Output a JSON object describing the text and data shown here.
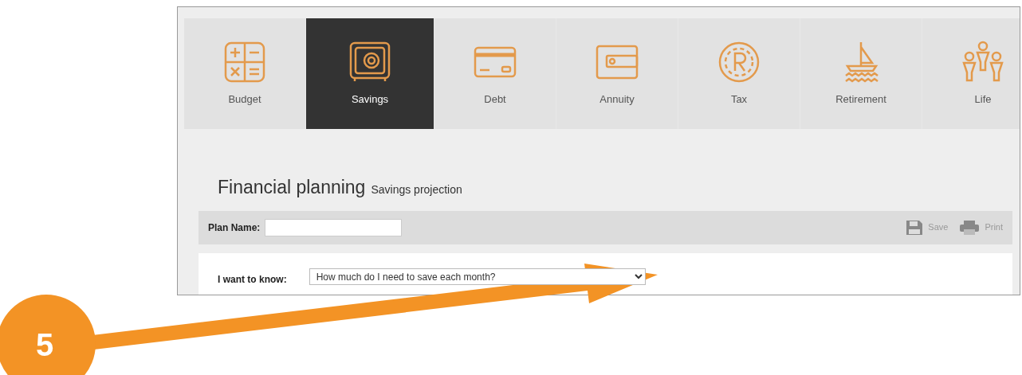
{
  "tabs": [
    {
      "label": "Budget",
      "selected": false
    },
    {
      "label": "Savings",
      "selected": true
    },
    {
      "label": "Debt",
      "selected": false
    },
    {
      "label": "Annuity",
      "selected": false
    },
    {
      "label": "Tax",
      "selected": false
    },
    {
      "label": "Retirement",
      "selected": false
    },
    {
      "label": "Life",
      "selected": false
    }
  ],
  "heading": {
    "title": "Financial planning",
    "subtitle": "Savings projection"
  },
  "toolbar": {
    "plan_name_label": "Plan Name:",
    "actions": [
      "Save",
      "Print"
    ]
  },
  "form": {
    "question_label": "I want to know:",
    "question_value": "How much do I need to save each month?"
  },
  "annotation": {
    "number": "5"
  }
}
